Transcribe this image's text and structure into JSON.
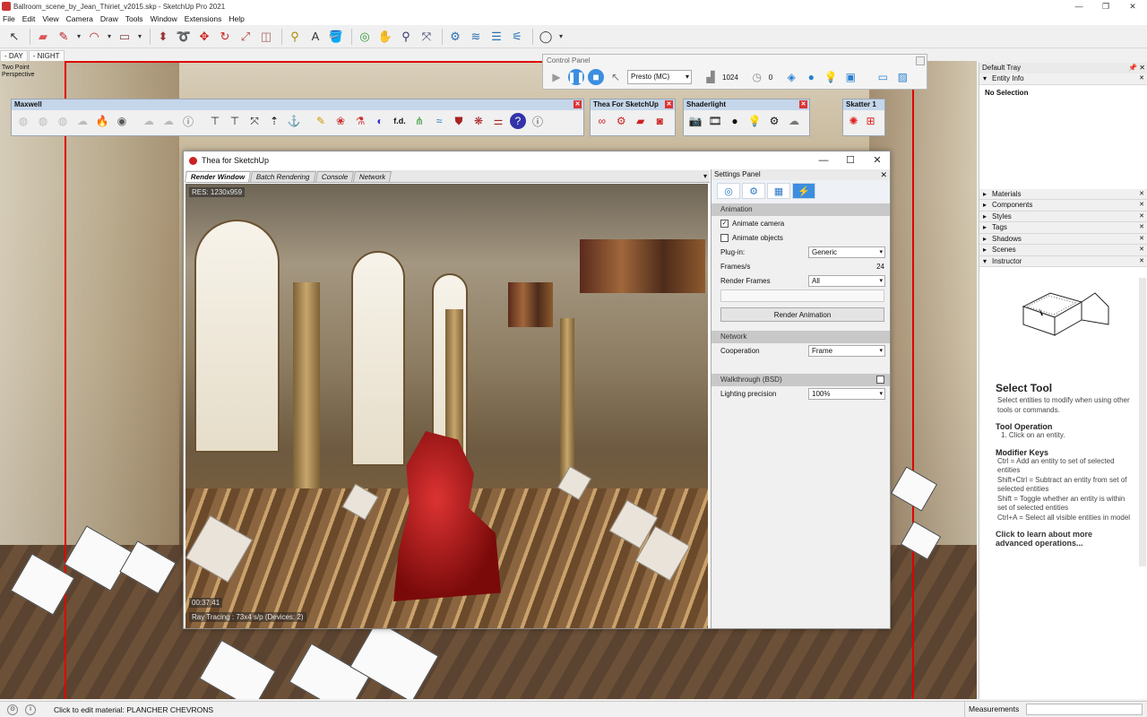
{
  "window": {
    "title": "Ballroom_scene_by_Jean_Thiriet_v2015.skp - SketchUp Pro 2021",
    "controls": [
      "—",
      "❐",
      "✕"
    ]
  },
  "menu": [
    "File",
    "Edit",
    "View",
    "Camera",
    "Draw",
    "Tools",
    "Window",
    "Extensions",
    "Help"
  ],
  "scene_tabs": [
    "- DAY",
    "- NIGHT"
  ],
  "viewport": {
    "perspective_label": "Two Point Perspective"
  },
  "toolbars": {
    "maxwell": {
      "title": "Maxwell",
      "icons": [
        "sky-icon",
        "cloud-icon",
        "fire-icon",
        "target-icon",
        "info-icon"
      ]
    },
    "thea": {
      "title": "Thea For SketchUp"
    },
    "shaderlight": {
      "title": "Shaderlight"
    },
    "skatter": {
      "title": "Skatter 1"
    },
    "fd_label": "f.d."
  },
  "control_panel": {
    "title": "Control Panel",
    "engine": "Presto (MC)",
    "samples": "1024",
    "time": "0"
  },
  "thea_window": {
    "title": "Thea for SketchUp",
    "tabs": [
      "Render Window",
      "Batch Rendering",
      "Console",
      "Network"
    ],
    "active_tab": "Render Window",
    "res_label": "RES: 1230x959",
    "time_label": "00:37:41",
    "status_label": "Ray Tracing : 73x4 s/p (Devices: 2)"
  },
  "settings_panel": {
    "title": "Settings Panel",
    "animation": {
      "header": "Animation",
      "animate_camera": "Animate camera",
      "animate_camera_checked": true,
      "animate_objects": "Animate objects",
      "animate_objects_checked": false,
      "plugin_label": "Plug-in:",
      "plugin_value": "Generic",
      "fps_label": "Frames/s",
      "fps_value": "24",
      "render_frames_label": "Render Frames",
      "render_frames_value": "All",
      "render_button": "Render Animation"
    },
    "network": {
      "header": "Network",
      "cooperation_label": "Cooperation",
      "cooperation_value": "Frame"
    },
    "walkthrough": {
      "header": "Walkthrough (BSD)",
      "lighting_label": "Lighting precision",
      "lighting_value": "100%"
    }
  },
  "tray": {
    "title": "Default Tray",
    "entity_info": "Entity Info",
    "no_selection": "No Selection",
    "sections": [
      "Materials",
      "Components",
      "Styles",
      "Tags",
      "Shadows",
      "Scenes",
      "Instructor"
    ],
    "instructor": {
      "title": "Select Tool",
      "desc": "Select entities to modify when using other tools or commands.",
      "op_title": "Tool Operation",
      "op_text": "1. Click on an entity.",
      "mod_title": "Modifier Keys",
      "mod_lines": [
        "Ctrl = Add an entity to set of selected entities",
        "Shift+Ctrl = Subtract an entity from set of selected entities",
        "Shift = Toggle whether an entity is within set of selected entities",
        "Ctrl+A = Select all visible entities in model"
      ],
      "link": "Click to learn about more advanced operations..."
    }
  },
  "status": {
    "message": "Click to edit material: PLANCHER CHEVRONS",
    "measurements": "Measurements"
  }
}
